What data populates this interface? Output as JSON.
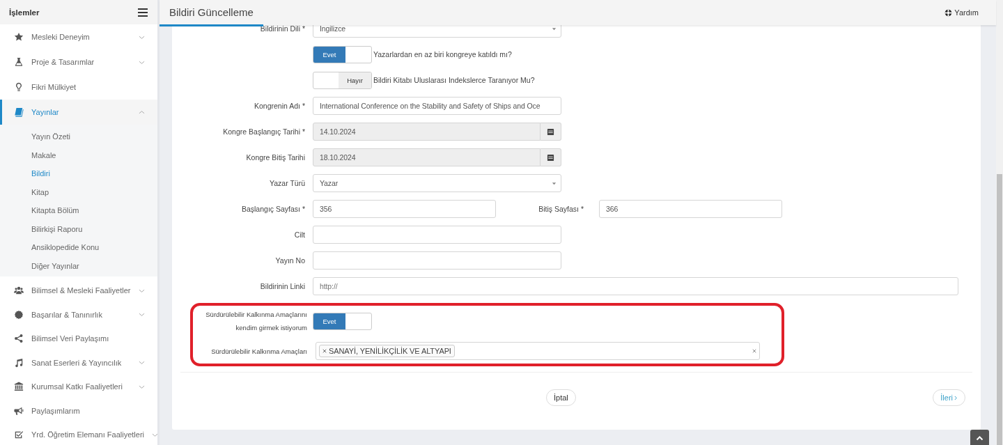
{
  "sidebar": {
    "title": "İşlemler",
    "items": [
      {
        "label": "Mesleki Deneyim",
        "selected": false,
        "expanded": false
      },
      {
        "label": "Proje & Tasarımlar",
        "selected": false,
        "expanded": false
      },
      {
        "label": "Fikri Mülkiyet",
        "selected": false
      },
      {
        "label": "Yayınlar",
        "selected": true,
        "expanded": true,
        "children": [
          {
            "label": "Yayın Özeti",
            "selected": false
          },
          {
            "label": "Makale",
            "selected": false
          },
          {
            "label": "Bildiri",
            "selected": true
          },
          {
            "label": "Kitap",
            "selected": false
          },
          {
            "label": "Kitapta Bölüm",
            "selected": false
          },
          {
            "label": "Bilirkişi Raporu",
            "selected": false
          },
          {
            "label": "Ansiklopedide Konu",
            "selected": false
          },
          {
            "label": "Diğer Yayınlar",
            "selected": false
          }
        ]
      },
      {
        "label": "Bilimsel & Mesleki Faaliyetler",
        "selected": false,
        "expanded": false
      },
      {
        "label": "Başarılar & Tanınırlık",
        "selected": false,
        "expanded": false
      },
      {
        "label": "Bilimsel Veri Paylaşımı",
        "selected": false
      },
      {
        "label": "Sanat Eserleri & Yayıncılık",
        "selected": false,
        "expanded": false
      },
      {
        "label": "Kurumsal Katkı Faaliyetleri",
        "selected": false,
        "expanded": false
      },
      {
        "label": "Paylaşımlarım",
        "selected": false
      },
      {
        "label": "Yrd. Öğretim Elemanı Faaliyetleri",
        "selected": false,
        "expanded": false
      }
    ]
  },
  "header": {
    "title": "Bildiri Güncelleme",
    "help": "Yardım"
  },
  "form": {
    "rows": [
      {
        "kind": "select",
        "label": "Bildirinin Dili *",
        "value": "İngilizce"
      },
      {
        "kind": "toggle",
        "on": true,
        "option": "Evet",
        "text": "Yazarlardan en az biri kongreye katıldı mı?"
      },
      {
        "kind": "toggle",
        "on": false,
        "option": "Hayır",
        "text": "Bildiri Kitabı Uluslarası Indekslerce Taranıyor Mu?"
      },
      {
        "kind": "text",
        "label": "Kongrenin Adı *",
        "value": "International Conference on the Stability and Safety of Ships and Oce"
      },
      {
        "kind": "date",
        "label": "Kongre Başlangıç Tarihi *",
        "value": "14.10.2024",
        "disabled": true
      },
      {
        "kind": "date",
        "label": "Kongre Bitiş Tarihi",
        "value": "18.10.2024",
        "disabled": true
      },
      {
        "kind": "select",
        "label": "Yazar Türü",
        "value": "Yazar"
      },
      {
        "kind": "pair",
        "label": "Başlangıç Sayfası *",
        "value": "356",
        "label_2": "Bitiş Sayfası *",
        "value_2": "366"
      },
      {
        "kind": "text",
        "label": "Cilt"
      },
      {
        "kind": "text",
        "label": "Yayın No"
      },
      {
        "kind": "url",
        "label": "Bildirinin Linki",
        "placeholder": "http://"
      }
    ],
    "highlighted_rows": [
      {
        "kind": "toggle",
        "label": "Sürdürülebilir Kalkınma Amaçlarını kendim girmek istiyorum",
        "on": true,
        "option": "Evet"
      },
      {
        "kind": "multiselect",
        "label": "Sürdürülebilir Kalkınma Amaçları",
        "tags": [
          "SANAYİ, YENİLİKÇİLİK VE ALTYAPI"
        ]
      }
    ],
    "buttons": [
      {
        "label": "İptal",
        "kind": "cancel"
      },
      {
        "label": "İleri",
        "kind": "next"
      }
    ]
  }
}
